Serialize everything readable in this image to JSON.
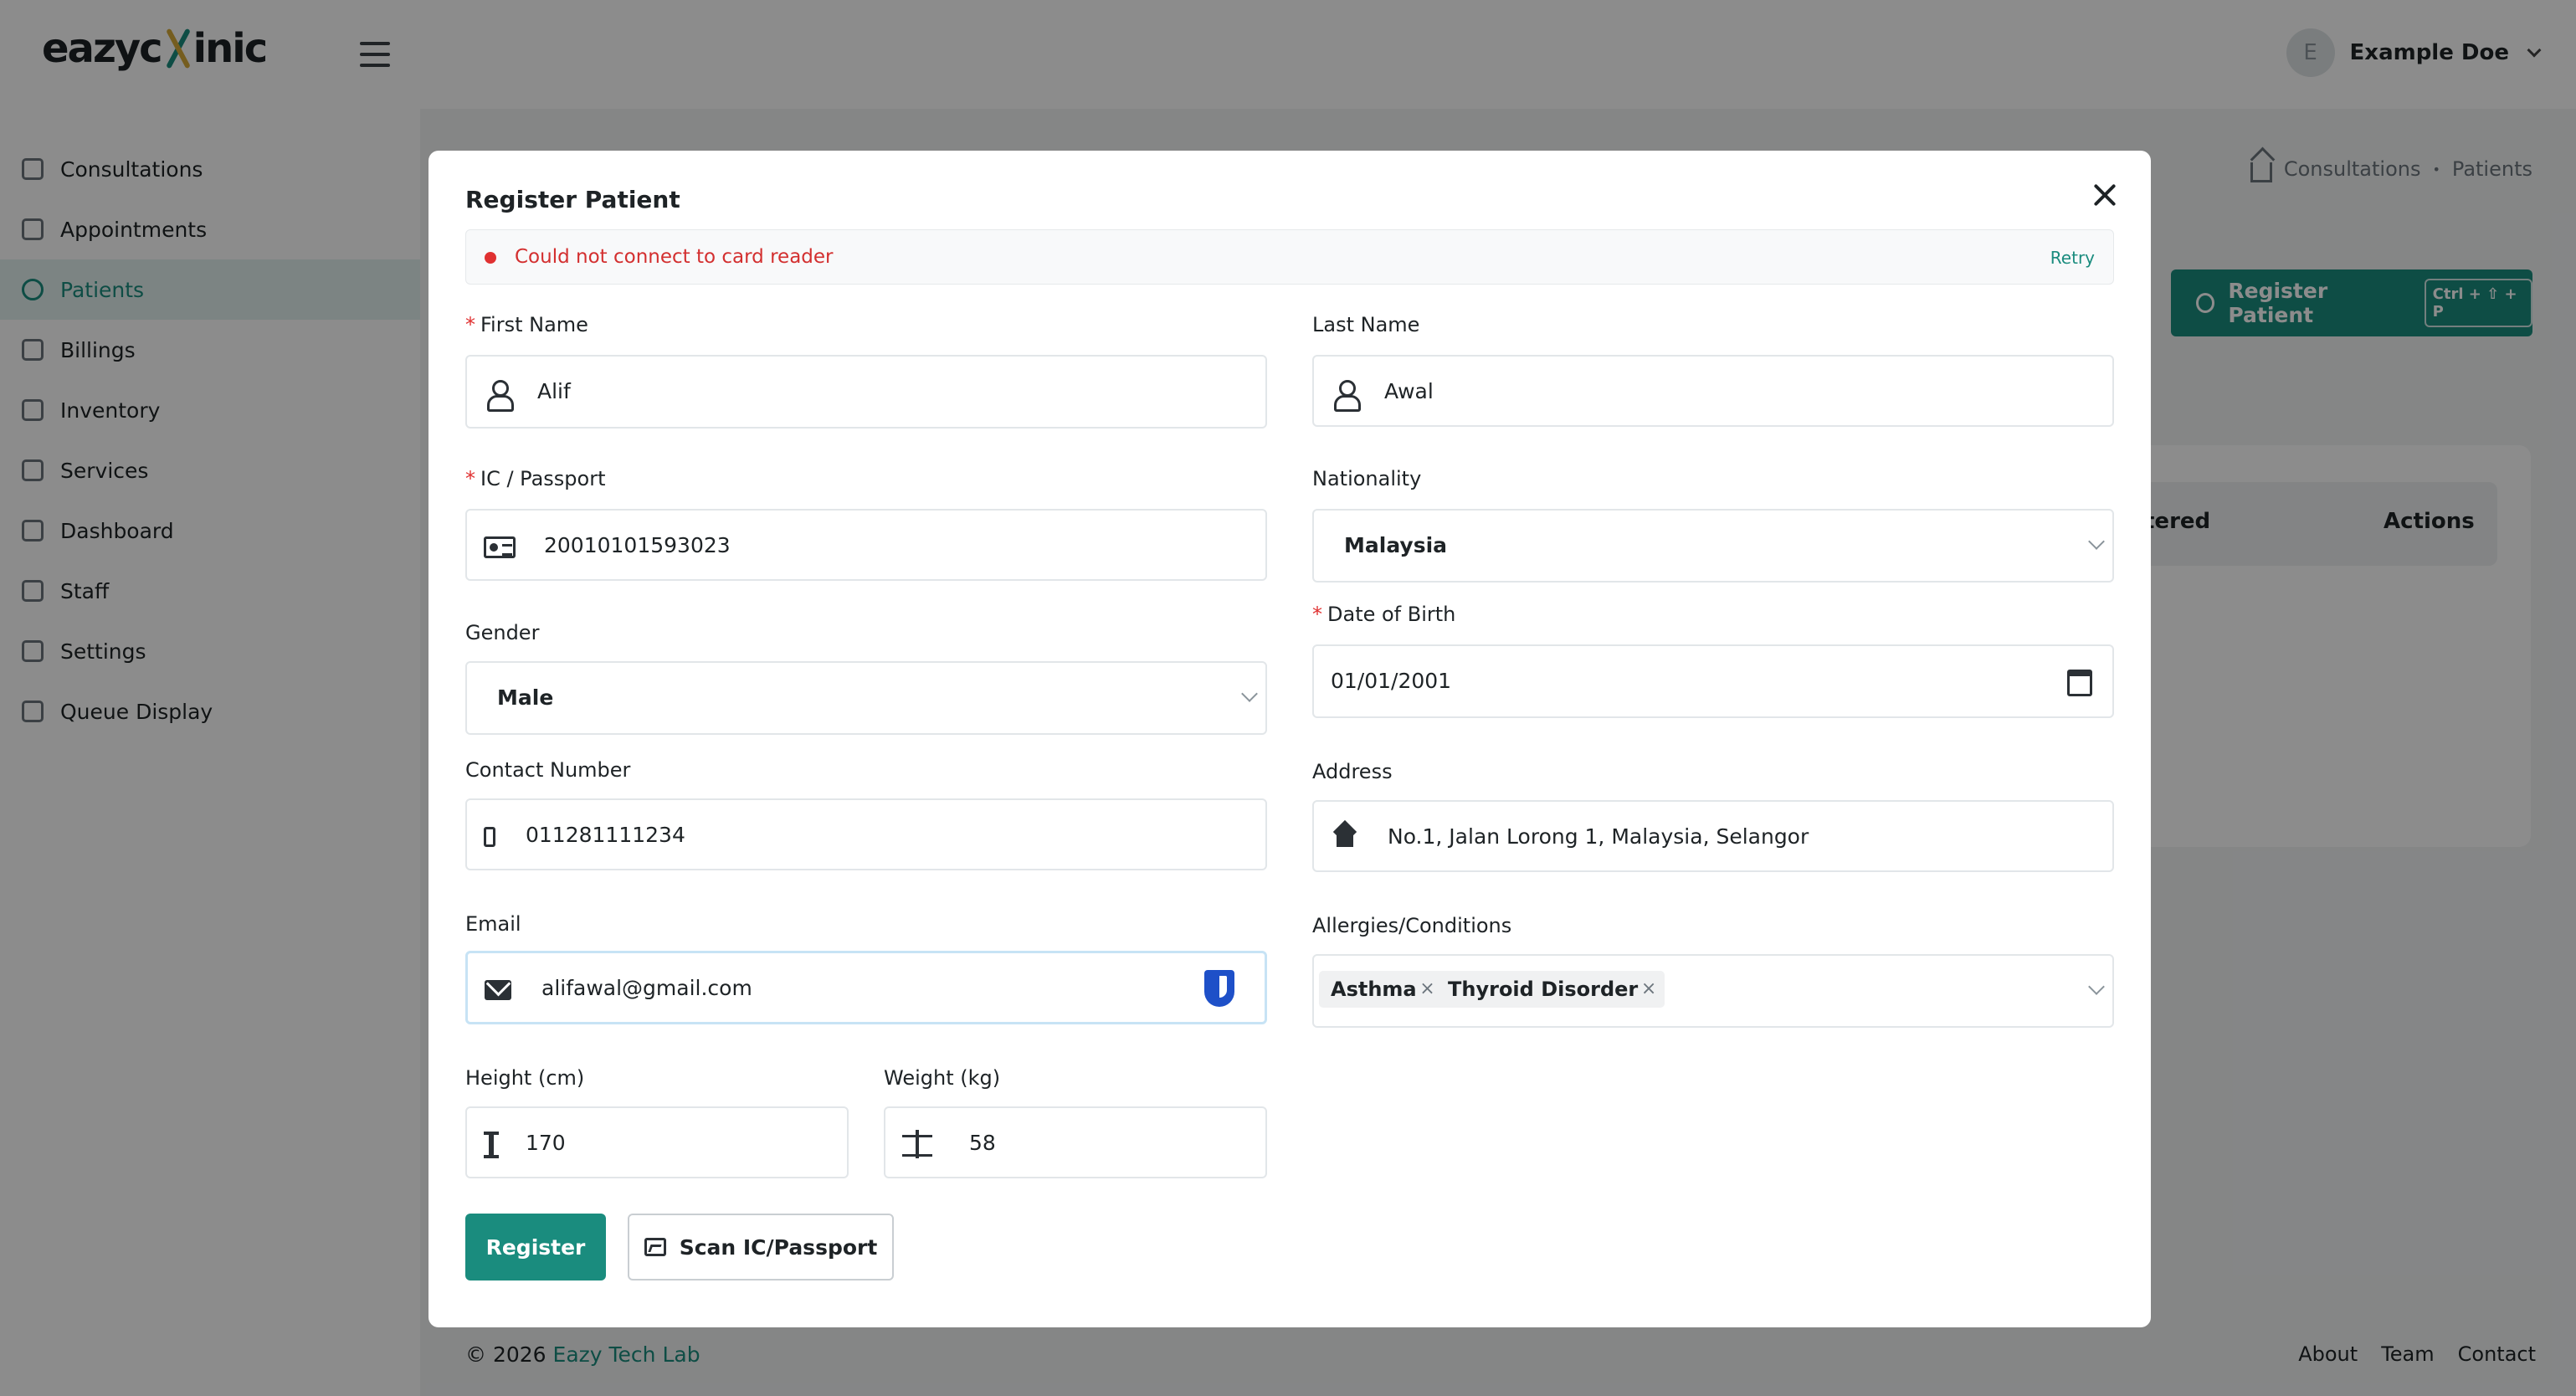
{
  "app": {
    "logo_prefix": "eazyc",
    "logo_suffix": "inic",
    "user_avatar_letter": "E",
    "user_name": "Example Doe"
  },
  "sidebar": {
    "items": [
      {
        "label": "Consultations",
        "icon": "stethoscope-icon",
        "active": false
      },
      {
        "label": "Appointments",
        "icon": "calendar-icon",
        "active": false
      },
      {
        "label": "Patients",
        "icon": "smile-icon",
        "active": true
      },
      {
        "label": "Billings",
        "icon": "billing-icon",
        "active": false
      },
      {
        "label": "Inventory",
        "icon": "pill-icon",
        "active": false
      },
      {
        "label": "Services",
        "icon": "swap-icon",
        "active": false
      },
      {
        "label": "Dashboard",
        "icon": "grid-icon",
        "active": false
      },
      {
        "label": "Staff",
        "icon": "users-icon",
        "active": false
      },
      {
        "label": "Settings",
        "icon": "gear-icon",
        "active": false
      },
      {
        "label": "Queue Display",
        "icon": "monitor-icon",
        "active": false
      }
    ]
  },
  "breadcrumb": {
    "items": [
      "Consultations",
      "Patients"
    ],
    "separator": "•"
  },
  "page": {
    "register_button": "Register Patient",
    "register_shortcut": "Ctrl + ⇧ + P",
    "table_headers": [
      "tered",
      "Actions"
    ]
  },
  "footer": {
    "copyright": "© 2026 ",
    "brand": "Eazy Tech Lab",
    "links": [
      "About",
      "Team",
      "Contact"
    ]
  },
  "modal": {
    "title": "Register Patient",
    "alert": {
      "message": "Could not connect to card reader",
      "action": "Retry",
      "color": "#d32f2f"
    },
    "fields": {
      "first_name": {
        "label": "First Name",
        "required": true,
        "value": "Alif"
      },
      "last_name": {
        "label": "Last Name",
        "required": false,
        "value": "Awal"
      },
      "ic_passport": {
        "label": "IC / Passport",
        "required": true,
        "value": "20010101593023"
      },
      "nationality": {
        "label": "Nationality",
        "value": "Malaysia"
      },
      "gender": {
        "label": "Gender",
        "value": "Male"
      },
      "dob": {
        "label": "Date of Birth",
        "required": true,
        "value": "01/01/2001"
      },
      "contact": {
        "label": "Contact Number",
        "value": "011281111234"
      },
      "address": {
        "label": "Address",
        "value": "No.1, Jalan Lorong 1, Malaysia, Selangor"
      },
      "email": {
        "label": "Email",
        "value": "alifawal@gmail.com"
      },
      "allergies": {
        "label": "Allergies/Conditions",
        "tags": [
          "Asthma",
          "Thyroid Disorder"
        ]
      },
      "height": {
        "label": "Height (cm)",
        "value": "170"
      },
      "weight": {
        "label": "Weight (kg)",
        "value": "58"
      }
    },
    "buttons": {
      "register": "Register",
      "scan": "Scan IC/Passport"
    }
  },
  "colors": {
    "accent": "#1a8c7e",
    "error": "#e03131"
  }
}
